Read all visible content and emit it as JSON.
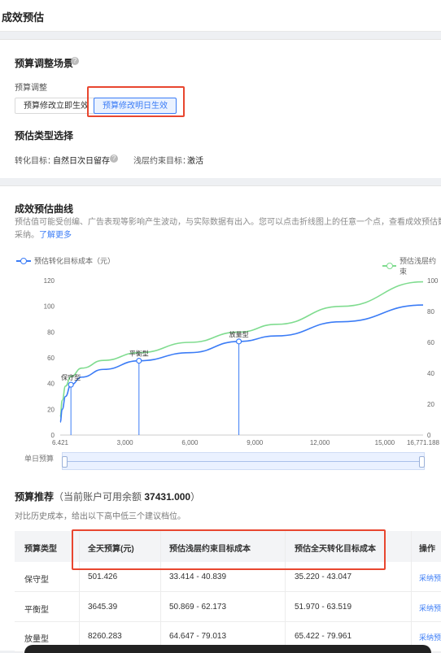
{
  "header": {
    "title": "成效预估"
  },
  "scene": {
    "title": "预算调整场景",
    "adjust_label": "预算调整",
    "options": [
      "预算修改立即生效",
      "预算修改明日生效"
    ],
    "selected": "预算修改明日生效"
  },
  "estimate_type": {
    "title": "预估类型选择",
    "conversion_label": "转化目标：",
    "conversion_value": "自然日次日留存",
    "shallow_label": "浅层约束目标：",
    "shallow_value": "激活"
  },
  "curve": {
    "title": "成效预估曲线",
    "desc_line1": "预估值可能受创编、广告表现等影响产生波动，与实际数据有出入。您可以点击折线图上的任意一个点，查看成效预估数据，",
    "desc_line2": "采纳。",
    "learn_more": "了解更多",
    "legend_left": "预估转化目标成本（元）",
    "legend_right": "预估浅层约束",
    "slider_label": "单日预算",
    "point_labels": [
      "保守型",
      "平衡型",
      "放量型"
    ]
  },
  "chart_data": {
    "type": "line",
    "xlabel": "",
    "x_ticks": [
      "6.421",
      "3,000",
      "6,000",
      "9,000",
      "12,000",
      "15,000",
      "16,771.188"
    ],
    "x_range": [
      6.421,
      16771.188
    ],
    "y_left_ticks": [
      0,
      20,
      40,
      60,
      80,
      100,
      120
    ],
    "y_left_range": [
      0,
      120
    ],
    "y_right_ticks": [
      0,
      20,
      40,
      60,
      80,
      100
    ],
    "y_right_range": [
      0,
      100
    ],
    "series": [
      {
        "name": "预估转化目标成本（元）",
        "color": "#3b7cf6",
        "axis": "left",
        "x": [
          6.421,
          100,
          250,
          501.426,
          1000,
          2000,
          3645.39,
          6000,
          8260.283,
          10000,
          13000,
          16771.188
        ],
        "y": [
          10,
          20,
          30,
          39.1,
          45,
          51,
          57.7,
          64,
          72.7,
          77,
          88,
          101
        ]
      },
      {
        "name": "预估浅层约束",
        "color": "#7fdc8f",
        "axis": "left",
        "x": [
          6.421,
          100,
          250,
          501.426,
          1000,
          2000,
          3645.39,
          6000,
          8260.283,
          10000,
          13000,
          16771.188
        ],
        "y": [
          14,
          27,
          38,
          45.5,
          52,
          58,
          64,
          72,
          80,
          86,
          100,
          119
        ]
      }
    ],
    "markers": [
      {
        "label": "保守型",
        "x": 501.426,
        "y": 39.1
      },
      {
        "label": "平衡型",
        "x": 3645.39,
        "y": 57.7
      },
      {
        "label": "放量型",
        "x": 8260.283,
        "y": 72.7
      }
    ],
    "grid": false,
    "legend": "top"
  },
  "recommend": {
    "title": "预算推荐",
    "balance_text": "（当前账户可用余额",
    "balance_value": "37431.000",
    "balance_close": "）",
    "subtitle": "对比历史成本，给出以下高中低三个建议档位。",
    "columns": [
      "预算类型",
      "全天预算(元)",
      "预估浅层约束目标成本",
      "预估全天转化目标成本",
      "操作"
    ],
    "rows": [
      {
        "type": "保守型",
        "budget": "501.426",
        "shallow": "33.414 - 40.839",
        "conv": "35.220 - 43.047",
        "action": "采纳预"
      },
      {
        "type": "平衡型",
        "budget": "3645.39",
        "shallow": "50.869 - 62.173",
        "conv": "51.970 - 63.519",
        "action": "采纳预"
      },
      {
        "type": "放量型",
        "budget": "8260.283",
        "shallow": "64.647 - 79.013",
        "conv": "65.422 - 79.961",
        "action": "采纳预"
      }
    ]
  }
}
